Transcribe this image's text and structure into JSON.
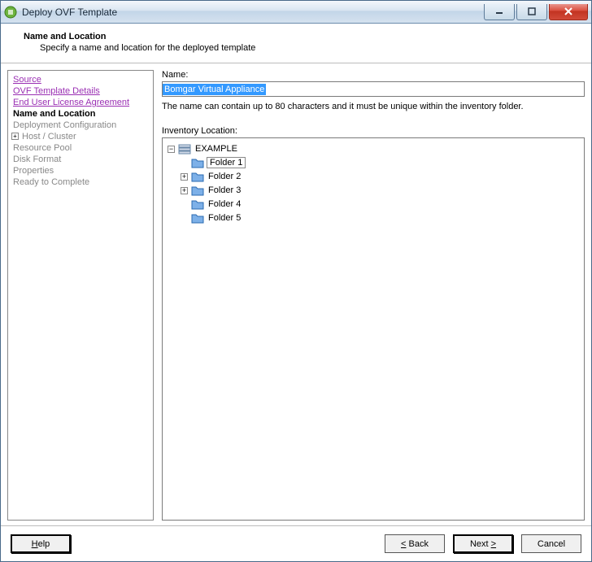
{
  "window": {
    "title": "Deploy OVF Template"
  },
  "header": {
    "title": "Name and Location",
    "subtitle": "Specify a name and location for the deployed template"
  },
  "sidebar": {
    "items": [
      {
        "label": "Source",
        "style": "link"
      },
      {
        "label": "OVF Template Details",
        "style": "link"
      },
      {
        "label": "End User License Agreement",
        "style": "link"
      },
      {
        "label": "Name and Location",
        "style": "bold"
      },
      {
        "label": "Deployment Configuration",
        "style": "gray"
      },
      {
        "label": "Host / Cluster",
        "style": "gray",
        "exp": "+"
      },
      {
        "label": "Resource Pool",
        "style": "gray"
      },
      {
        "label": "Disk Format",
        "style": "gray"
      },
      {
        "label": "Properties",
        "style": "gray"
      },
      {
        "label": "Ready to Complete",
        "style": "gray"
      }
    ]
  },
  "main": {
    "name_label": "Name:",
    "name_value": "Bomgar Virtual Appliance",
    "name_hint": "The name can contain up to 80 characters and it must be unique within the inventory folder.",
    "inventory_label": "Inventory Location:",
    "tree": {
      "root": "EXAMPLE",
      "folders": [
        {
          "label": "Folder 1",
          "selected": true
        },
        {
          "label": "Folder 2",
          "exp": "+"
        },
        {
          "label": "Folder 3",
          "exp": "+"
        },
        {
          "label": "Folder 4"
        },
        {
          "label": "Folder 5"
        }
      ]
    }
  },
  "footer": {
    "help": "Help",
    "back": "Back",
    "next": "Next",
    "cancel": "Cancel"
  }
}
